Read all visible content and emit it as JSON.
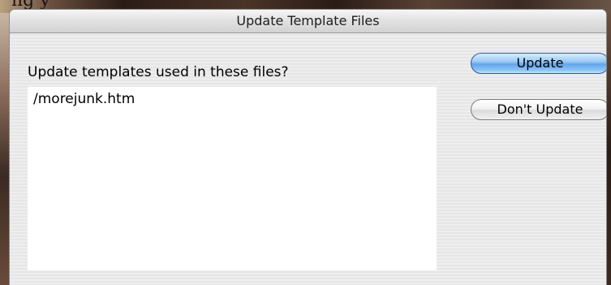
{
  "background": {
    "partial_text": "ng y"
  },
  "dialog": {
    "title": "Update Template Files",
    "prompt": "Update templates used in these files?",
    "files": [
      "/morejunk.htm"
    ],
    "buttons": {
      "update_label": "Update",
      "dont_update_label": "Don't Update"
    }
  },
  "colors": {
    "default_button": "#63a6ec",
    "list_background": "#ffffff",
    "dialog_background": "#ececec"
  }
}
